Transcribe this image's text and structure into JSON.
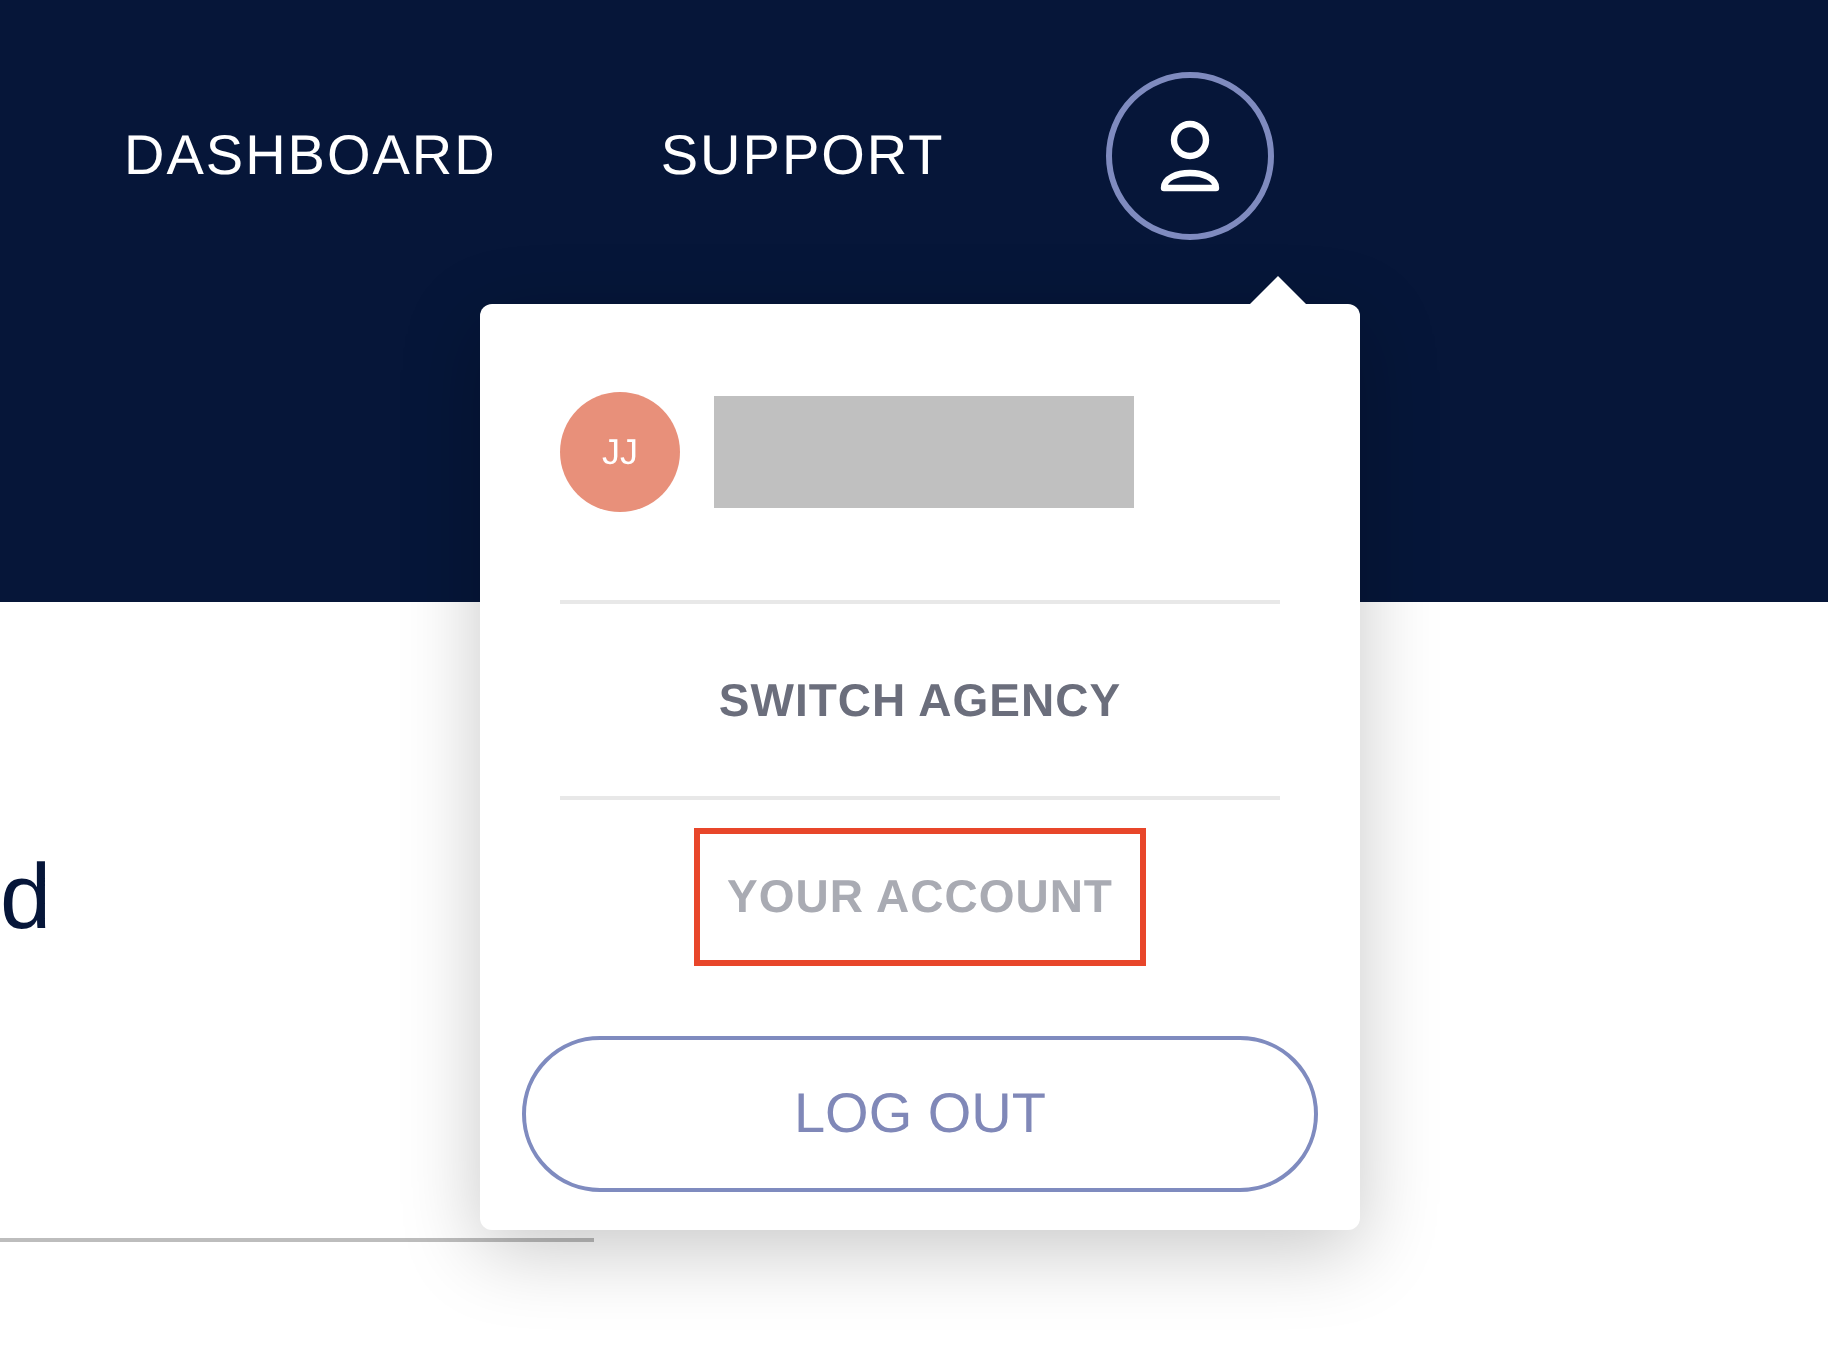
{
  "nav": {
    "items": [
      {
        "label": "DASHBOARD"
      },
      {
        "label": "SUPPORT"
      }
    ]
  },
  "content": {
    "heading_fragment": "d"
  },
  "account_menu": {
    "user": {
      "initials": "JJ",
      "color": "#e8907a",
      "name_redacted": true
    },
    "items": [
      {
        "label": "SWITCH AGENCY",
        "highlighted": false
      },
      {
        "label": "YOUR ACCOUNT",
        "highlighted": true
      }
    ],
    "logout": {
      "label": "LOG OUT"
    }
  }
}
